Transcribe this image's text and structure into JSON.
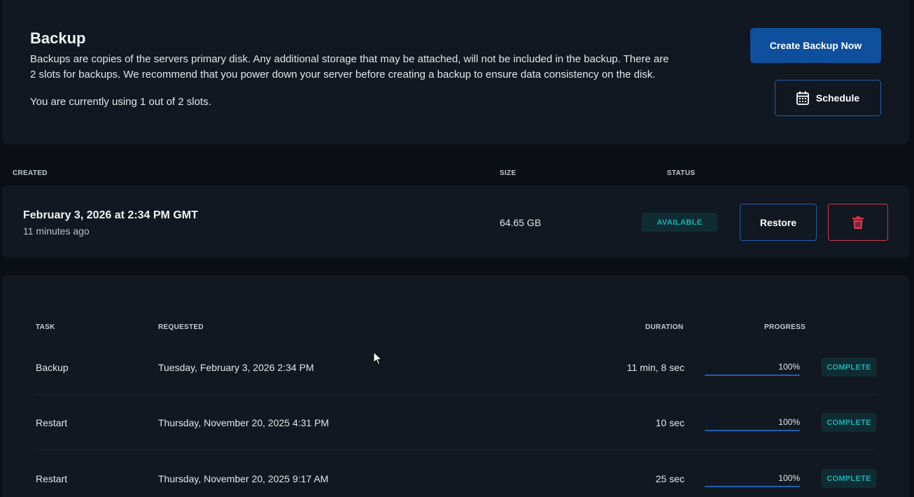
{
  "backup": {
    "title": "Backup",
    "description": "Backups are copies of the servers primary disk. Any additional storage that may be attached, will not be included in the backup. There are 2 slots for backups. We recommend that you power down your server before creating a backup to ensure data consistency on the disk.",
    "usage": "You are currently using 1 out of 2 slots.",
    "create_label": "Create Backup Now",
    "schedule_label": "Schedule"
  },
  "backups_table": {
    "columns": {
      "created": "CREATED",
      "size": "SIZE",
      "status": "STATUS"
    },
    "rows": [
      {
        "created": "February 3, 2026 at 2:34 PM GMT",
        "ago": "11 minutes ago",
        "size": "64.65 GB",
        "status": "AVAILABLE",
        "restore_label": "Restore"
      }
    ]
  },
  "tasks_table": {
    "columns": {
      "task": "TASK",
      "requested": "REQUESTED",
      "duration": "DURATION",
      "progress": "PROGRESS"
    },
    "rows": [
      {
        "task": "Backup",
        "requested": "Tuesday, February 3, 2026 2:34 PM",
        "duration": "11 min, 8 sec",
        "progress": "100%",
        "progress_value": 100,
        "status": "COMPLETE"
      },
      {
        "task": "Restart",
        "requested": "Thursday, November 20, 2025 4:31 PM",
        "duration": "10 sec",
        "progress": "100%",
        "progress_value": 100,
        "status": "COMPLETE"
      },
      {
        "task": "Restart",
        "requested": "Thursday, November 20, 2025 9:17 AM",
        "duration": "25 sec",
        "progress": "100%",
        "progress_value": 100,
        "status": "COMPLETE"
      }
    ]
  },
  "colors": {
    "background": "#0b0f15",
    "card": "#121821",
    "primary": "#0d4f9b",
    "outline": "#1d5fae",
    "danger": "#d1334a",
    "status_text": "#1eb0b4",
    "status_bg": "#0f2c33"
  },
  "icons": {
    "schedule": "calendar-icon",
    "delete": "trash-icon"
  }
}
